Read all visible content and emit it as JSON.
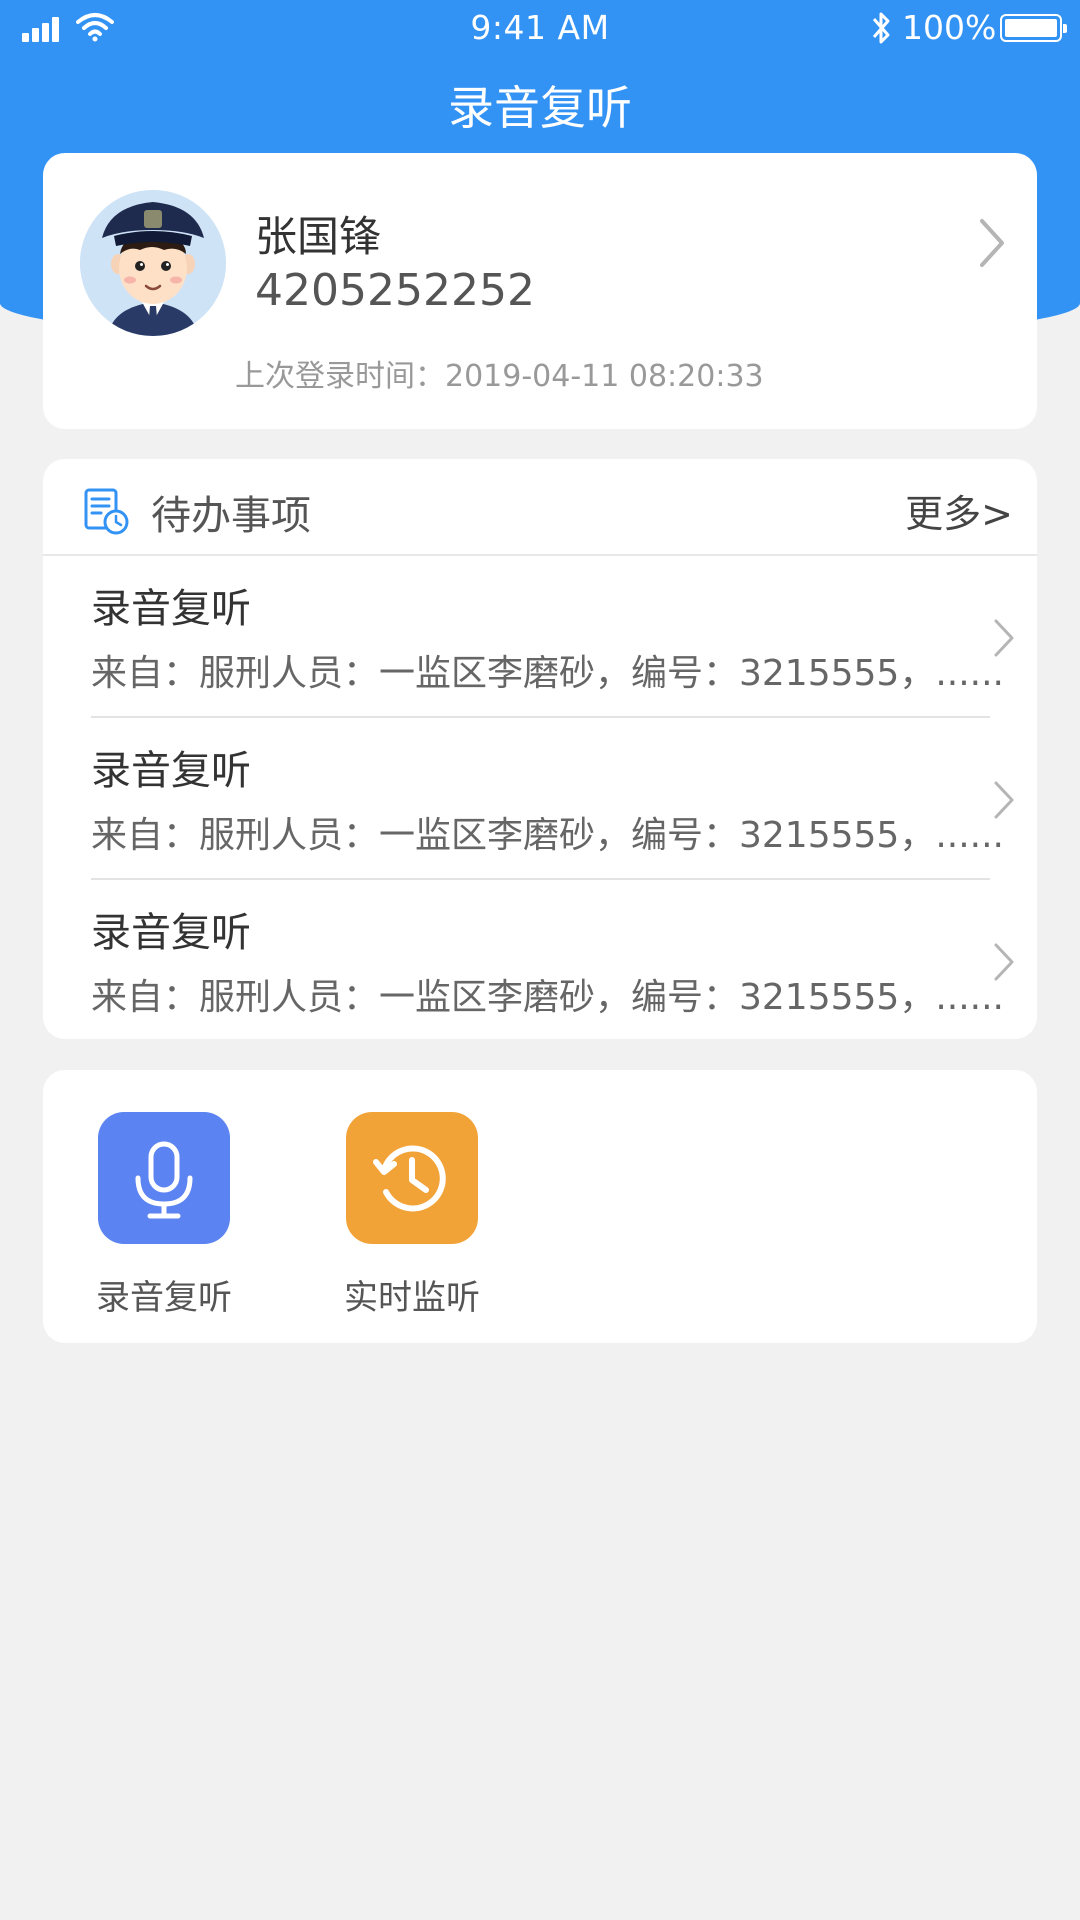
{
  "status_bar": {
    "time": "9:41 AM",
    "battery": "100%",
    "icons": [
      "signal-icon",
      "wifi-icon",
      "bluetooth-icon",
      "battery-icon"
    ]
  },
  "header": {
    "title": "录音复听",
    "background_color": "#3393f5"
  },
  "profile": {
    "name": "张国锋",
    "id": "4205252252",
    "last_login": "上次登录时间：2019-04-11 08:20:33",
    "avatar": "police-officer-avatar"
  },
  "todo": {
    "title": "待办事项",
    "more": "更多>",
    "items": [
      {
        "title": "录音复听",
        "detail": "来自：服刑人员：一监区李磨砂，编号：3215555，......"
      },
      {
        "title": "录音复听",
        "detail": "来自：服刑人员：一监区李磨砂，编号：3215555，......"
      },
      {
        "title": "录音复听",
        "detail": "来自：服刑人员：一监区李磨砂，编号：3215555，......"
      }
    ]
  },
  "apps": [
    {
      "label": "录音复听",
      "icon": "microphone-icon",
      "color": "#5b83f2"
    },
    {
      "label": "实时监听",
      "icon": "history-icon",
      "color": "#f2a338"
    }
  ]
}
